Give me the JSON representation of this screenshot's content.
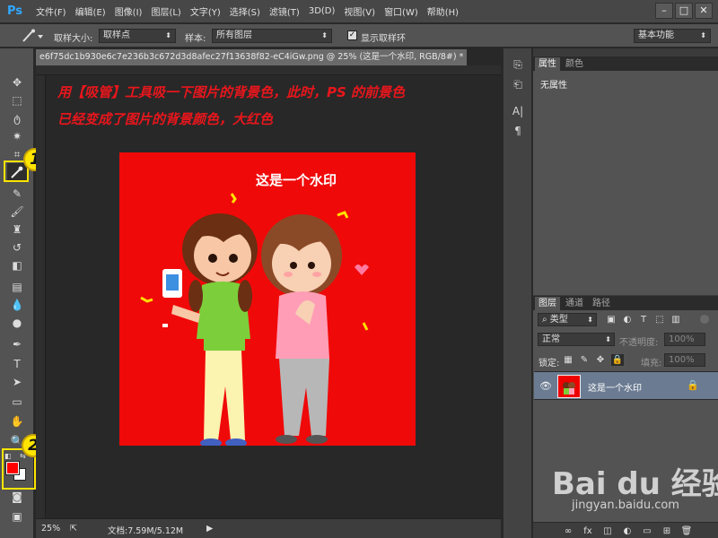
{
  "app": {
    "logo": "Ps"
  },
  "menu": [
    "文件(F)",
    "编辑(E)",
    "图像(I)",
    "图层(L)",
    "文字(Y)",
    "选择(S)",
    "滤镜(T)",
    "3D(D)",
    "视图(V)",
    "窗口(W)",
    "帮助(H)"
  ],
  "window_controls": {
    "minimize": "–",
    "maximize": "□",
    "close": "✕"
  },
  "options_bar": {
    "sample_size_label": "取样大小:",
    "sample_size_value": "取样点",
    "sample_label": "样本:",
    "sample_value": "所有图层",
    "show_ring_label": "显示取样环",
    "show_ring_checked": true,
    "workspace_value": "基本功能"
  },
  "document": {
    "tab_title": "e6f75dc1b930e6c7e236b3c672d3d8afec27f13638f82-eC4iGw.png @ 25% (这是一个水印, RGB/8#) *",
    "tab_close": "×",
    "overlay_line1": "用【吸管】工具吸一下图片的背景色，此时，PS 的前景色",
    "overlay_line2": "已经变成了图片的背景颜色，大红色",
    "watermark_text": "这是一个水印",
    "zoom": "25%",
    "doc_size": "文档:7.59M/5.12M"
  },
  "badges": {
    "eyedropper": "1",
    "colors": "2"
  },
  "colors": {
    "foreground": "#ff0000",
    "background": "#ffffff",
    "image_bg": "#f00909",
    "overlay_text": "#e8161c",
    "highlight": "#ffe400"
  },
  "properties_panel": {
    "tabs": [
      "属性",
      "颜色"
    ],
    "content": "无属性"
  },
  "layers_panel": {
    "tabs": [
      "图层",
      "通道",
      "路径"
    ],
    "filter_value": "类型",
    "blend_mode": "正常",
    "opacity_label": "不透明度:",
    "opacity_value": "100%",
    "lock_label": "锁定:",
    "fill_label": "填充:",
    "fill_value": "100%",
    "layers": [
      {
        "name": "这是一个水印",
        "visible": true,
        "locked": true
      }
    ],
    "footer_icons": [
      "link-icon",
      "fx-icon",
      "mask-icon",
      "adjustment-icon",
      "group-icon",
      "new-layer-icon",
      "trash-icon"
    ]
  },
  "watermark": {
    "brand": "Bai du 经验",
    "url": "jingyan.baidu.com"
  },
  "icons": {
    "tools": [
      "move-icon",
      "marquee-icon",
      "lasso-icon",
      "magic-wand-icon",
      "crop-icon",
      "eyedropper-icon",
      "healing-brush-icon",
      "brush-icon",
      "clone-stamp-icon",
      "history-brush-icon",
      "eraser-icon",
      "gradient-icon",
      "blur-icon",
      "dodge-icon",
      "pen-icon",
      "type-icon",
      "path-selection-icon",
      "shape-icon",
      "hand-icon",
      "zoom-icon",
      "swap-colors-icon",
      "quick-mask-icon",
      "screen-mode-icon"
    ]
  }
}
